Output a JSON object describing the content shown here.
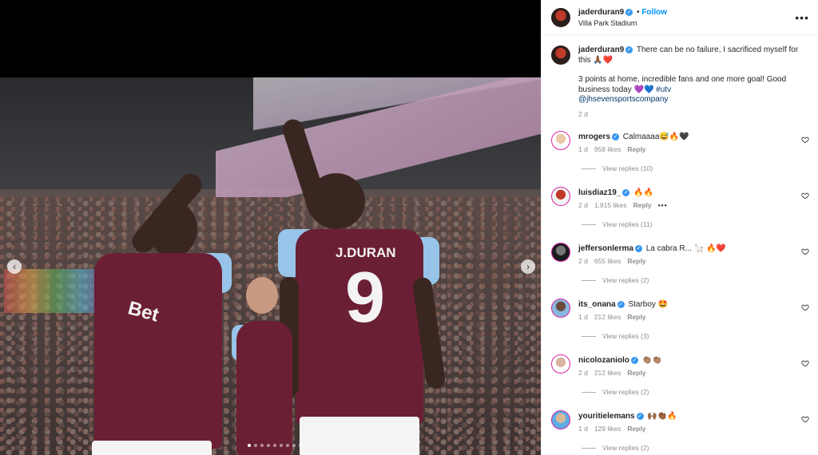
{
  "post": {
    "author": "jaderduran9",
    "location": "Villa Park Stadium",
    "follow_label": "Follow",
    "more_label": "•••",
    "caption_line1": "There can be no failure, I sacrificed myself for this 🙏🏾❤️",
    "caption_line2": "3 points at home, incredible fans and one more goal! Good business today 💜💙 ",
    "hashtag": "#utv",
    "mention": "@jhsevensportscompany",
    "time": "2 d",
    "jersey_name": "J.DURAN",
    "jersey_number": "9",
    "carousel": {
      "total": 10,
      "active_index": 0,
      "prev_label": "‹",
      "next_label": "›"
    }
  },
  "comments": [
    {
      "user": "mrogers",
      "text": "Calmaaaa😅🔥🖤",
      "time": "1 d",
      "likes": "958 likes",
      "reply": "Reply",
      "replies": "View replies (10)",
      "has_more": false
    },
    {
      "user": "luisdiaz19_",
      "text": "🔥🔥",
      "time": "2 d",
      "likes": "1,915 likes",
      "reply": "Reply",
      "replies": "View replies (11)",
      "has_more": true,
      "more": "•••"
    },
    {
      "user": "jeffersonlerma",
      "text": "La cabra R... 🦙 🔥❤️",
      "time": "2 d",
      "likes": "655 likes",
      "reply": "Reply",
      "replies": "View replies (2)",
      "has_more": false
    },
    {
      "user": "its_onana",
      "text": "Starboy 🤩",
      "time": "1 d",
      "likes": "212 likes",
      "reply": "Reply",
      "replies": "View replies (3)",
      "has_more": false
    },
    {
      "user": "nicolozaniolo",
      "text": "👏🏽👏🏽",
      "time": "2 d",
      "likes": "212 likes",
      "reply": "Reply",
      "replies": "View replies (2)",
      "has_more": false
    },
    {
      "user": "youritielemans",
      "text": "🙌🏾👏🏾🔥",
      "time": "1 d",
      "likes": "129 likes",
      "reply": "Reply",
      "replies": "View replies (2)",
      "has_more": false
    }
  ],
  "icons": {
    "verified": "verified-badge-icon",
    "heart": "heart-outline-icon"
  },
  "colors": {
    "link": "#0095f6",
    "verified": "#3897f0",
    "muted": "#8e8e8e",
    "shirt": "#6b1f34",
    "sleeve": "#97c4e8"
  }
}
